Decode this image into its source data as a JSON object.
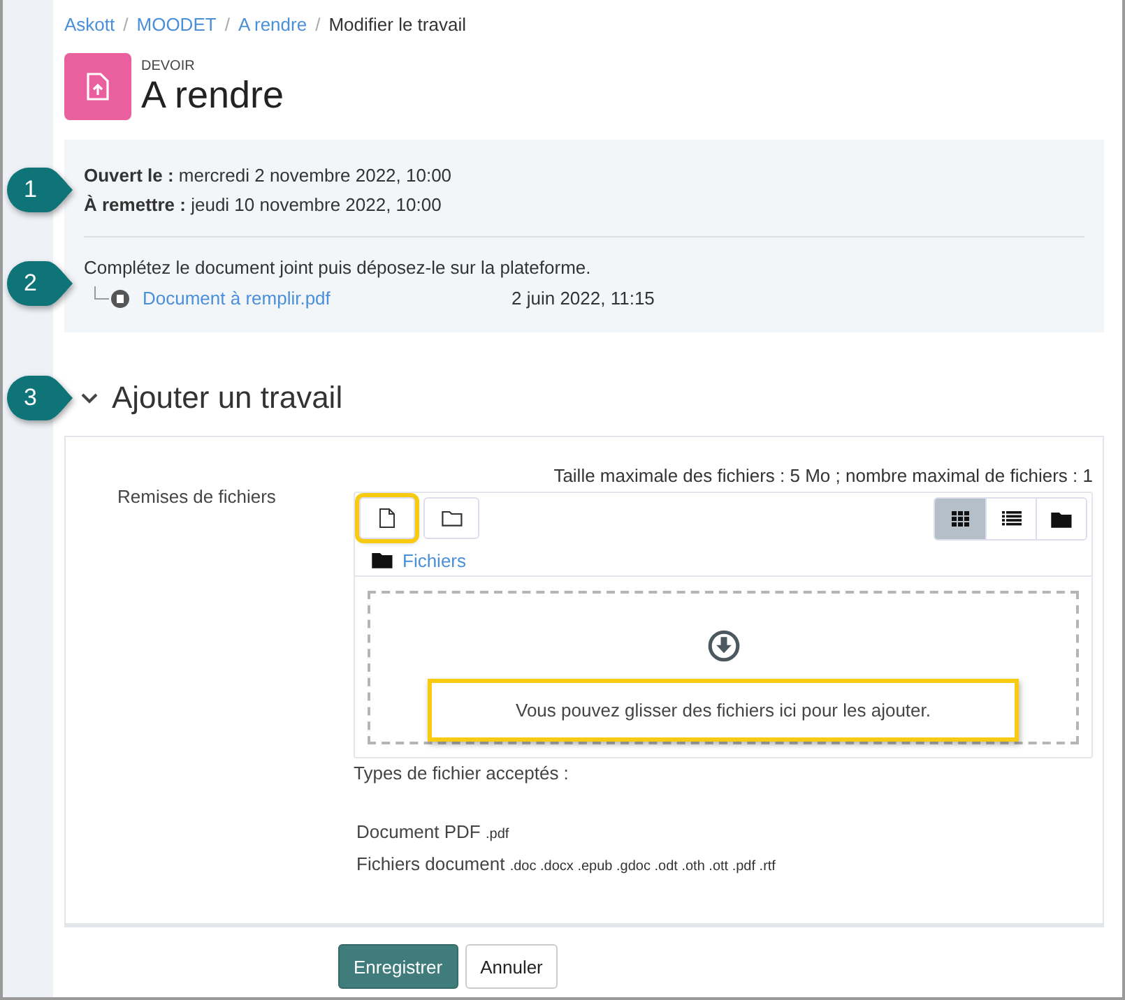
{
  "breadcrumb": {
    "separator": "/",
    "items": [
      {
        "label": "Askott",
        "link": true
      },
      {
        "label": "MOODET",
        "link": true
      },
      {
        "label": "A rendre",
        "link": true
      },
      {
        "label": "Modifier le travail",
        "link": false
      }
    ]
  },
  "activity": {
    "type_label": "DEVOIR",
    "title": "A rendre"
  },
  "info": {
    "callout": "1",
    "dates": [
      {
        "label": "Ouvert le :",
        "value": "mercredi 2 novembre 2022, 10:00"
      },
      {
        "label": "À remettre :",
        "value": "jeudi 10 novembre 2022, 10:00"
      }
    ],
    "description_callout": "2",
    "description": "Complétez le document joint puis déposez-le sur la plateforme.",
    "attachment": {
      "name": "Document à remplir.pdf",
      "date": "2 juin 2022, 11:15"
    }
  },
  "section": {
    "callout": "3",
    "title": "Ajouter un travail",
    "expanded": true,
    "field_label": "Remises de fichiers",
    "limits": "Taille maximale des fichiers : 5 Mo ; nombre maximal de fichiers : 1",
    "toolbar_buttons": [
      {
        "kind": "add-file",
        "highlighted": true
      },
      {
        "kind": "add-folder",
        "highlighted": false
      }
    ],
    "view_modes": [
      {
        "kind": "grid",
        "selected": true
      },
      {
        "kind": "list",
        "selected": false
      },
      {
        "kind": "tree",
        "selected": false
      }
    ],
    "path": "Fichiers",
    "dropzone_message": {
      "text": "Vous pouvez glisser des fichiers ici pour les ajouter.",
      "highlighted": true
    },
    "accepted_label": "Types de fichier acceptés :",
    "accepted_types": [
      {
        "name": "Document PDF",
        "extensions": ".pdf"
      },
      {
        "name": "Fichiers document",
        "extensions": ".doc .docx .epub .gdoc .odt .oth .ott .pdf .rtf"
      }
    ]
  },
  "buttons": [
    {
      "label": "Enregistrer",
      "kind": "primary"
    },
    {
      "label": "Annuler",
      "kind": "secondary"
    }
  ]
}
